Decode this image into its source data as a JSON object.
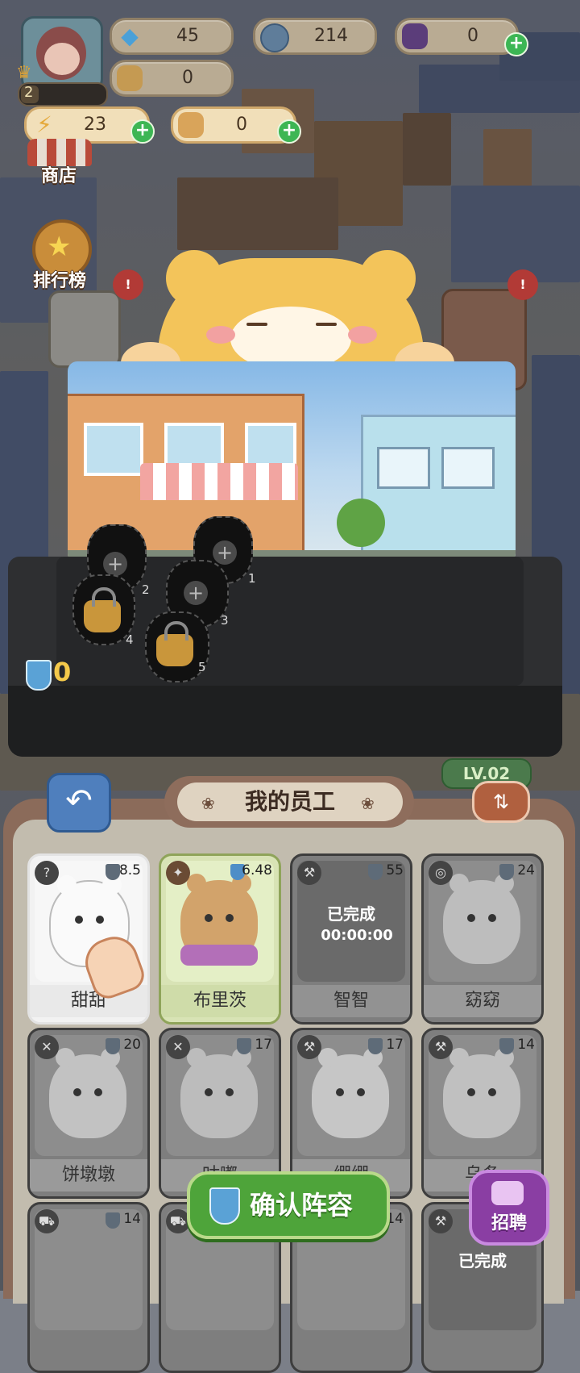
{
  "hud": {
    "diamonds": "45",
    "coins": "214",
    "tickets": "0",
    "boxes": "0",
    "player_level": "2",
    "energy": "23",
    "vouchers": "0"
  },
  "side": {
    "shop_label": "商店",
    "rank_label": "排行榜"
  },
  "stage": {
    "power_value": "0",
    "slots": [
      "1",
      "2",
      "3",
      "4",
      "5"
    ],
    "level_badge": "LV.02"
  },
  "panel": {
    "title": "我的员工",
    "confirm_label": "确认阵容",
    "recruit_label": "招聘"
  },
  "cards": [
    {
      "name": "甜甜",
      "score": "8.5",
      "tag": "?",
      "completed": ""
    },
    {
      "name": "布里茨",
      "score": "6.48",
      "tag": "",
      "completed": ""
    },
    {
      "name": "智智",
      "score": "55",
      "tag": "",
      "completed": "已完成",
      "timer": "00:00:00"
    },
    {
      "name": "窈窈",
      "score": "24",
      "tag": "",
      "completed": ""
    },
    {
      "name": "饼墩墩",
      "score": "20",
      "tag": "",
      "completed": ""
    },
    {
      "name": "咕嘟",
      "score": "17",
      "tag": "",
      "completed": ""
    },
    {
      "name": "绷绷",
      "score": "17",
      "tag": "",
      "completed": ""
    },
    {
      "name": "乌条",
      "score": "14",
      "tag": "",
      "completed": ""
    },
    {
      "name": "",
      "score": "14",
      "tag": "",
      "completed": ""
    },
    {
      "name": "",
      "score": "",
      "tag": "",
      "completed": ""
    },
    {
      "name": "",
      "score": "14",
      "tag": "",
      "completed": ""
    },
    {
      "name": "",
      "score": "",
      "tag": "",
      "completed": "已完成"
    }
  ],
  "colors": {
    "accent_green": "#4ea43a",
    "panel_brown": "#8b6b5a",
    "gold": "#f4c94a"
  }
}
